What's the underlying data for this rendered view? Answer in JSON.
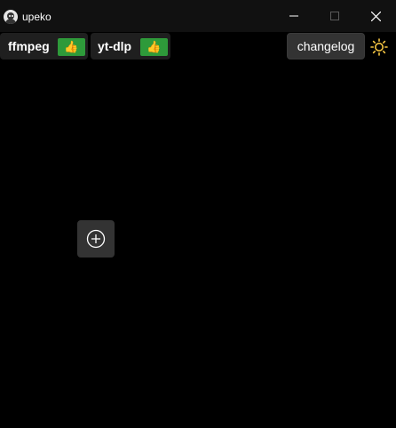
{
  "window": {
    "title": "upeko",
    "app_icon": "upeko-logo-icon",
    "controls": {
      "minimize_icon": "minimize-icon",
      "maximize_icon": "maximize-icon",
      "close_icon": "close-icon"
    }
  },
  "toolbar": {
    "dependencies": [
      {
        "label": "ffmpeg",
        "status_icon": "thumbs-up-icon",
        "status_glyph": "👍",
        "status_color": "#2e9a3a"
      },
      {
        "label": "yt-dlp",
        "status_icon": "thumbs-up-icon",
        "status_glyph": "👍",
        "status_color": "#2e9a3a"
      }
    ],
    "changelog_label": "changelog",
    "theme_toggle_icon": "sun-icon",
    "theme_toggle_color": "#f5c542"
  },
  "main": {
    "add_button_icon": "plus-circle-icon"
  },
  "colors": {
    "background": "#000000",
    "titlebar": "#111111",
    "chip": "#1f1f1f",
    "button": "#333333",
    "accent_green": "#2e9a3a"
  }
}
